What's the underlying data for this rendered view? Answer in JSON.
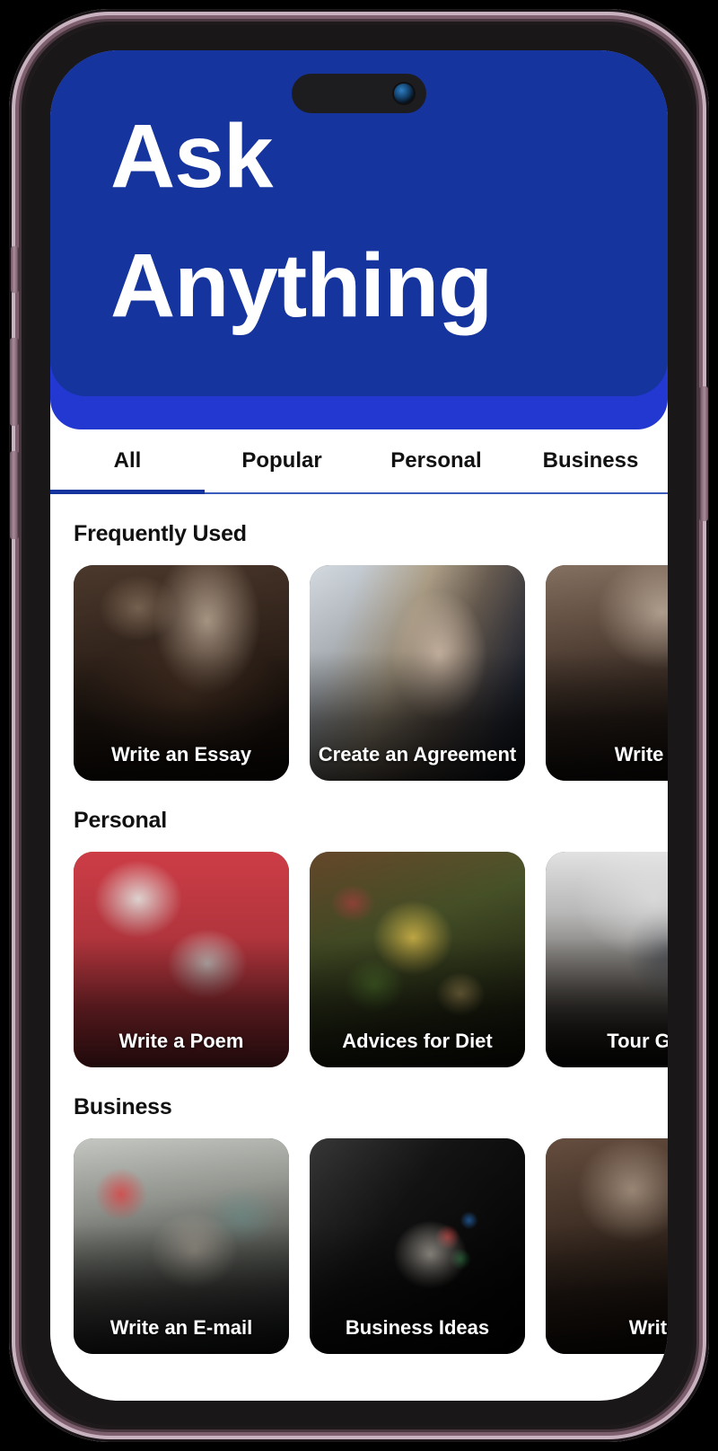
{
  "device": {
    "frame_name": "smartphone-mockup",
    "frame_color": "#7d5f6d",
    "island_name": "dynamic-island"
  },
  "header": {
    "title": "Ask\nAnything",
    "background_color": "#15349d",
    "accent_color": "#2337d1",
    "text_color": "#ffffff"
  },
  "tabs": {
    "active_index": 0,
    "active_color": "#15349d",
    "items": [
      {
        "label": "All"
      },
      {
        "label": "Popular"
      },
      {
        "label": "Personal"
      },
      {
        "label": "Business"
      }
    ]
  },
  "sections": [
    {
      "title": "Frequently Used",
      "cards": [
        {
          "label": "Write an Essay",
          "photo": "ph-essay",
          "photo_name": "photo-woman-writing"
        },
        {
          "label": "Create an Agreement",
          "photo": "ph-agreement",
          "photo_name": "photo-handshake-contract"
        },
        {
          "label": "Write an",
          "photo": "ph-report",
          "photo_name": "photo-person-writing-clipped"
        }
      ]
    },
    {
      "title": "Personal",
      "cards": [
        {
          "label": "Write a Poem",
          "photo": "ph-poem",
          "photo_name": "photo-love-letter-notebook"
        },
        {
          "label": "Advices for Diet",
          "photo": "ph-diet",
          "photo_name": "photo-healthy-food-bowl"
        },
        {
          "label": "Tour Guid",
          "photo": "ph-tour",
          "photo_name": "photo-hikers-mountain-clipped"
        }
      ]
    },
    {
      "title": "Business",
      "cards": [
        {
          "label": "Write an E-mail",
          "photo": "ph-email",
          "photo_name": "photo-woman-at-sign"
        },
        {
          "label": "Business Ideas",
          "photo": "ph-ideas",
          "photo_name": "photo-lightbulb-charts"
        },
        {
          "label": "Write",
          "photo": "ph-writeplan",
          "photo_name": "photo-writing-clipped"
        }
      ]
    }
  ]
}
